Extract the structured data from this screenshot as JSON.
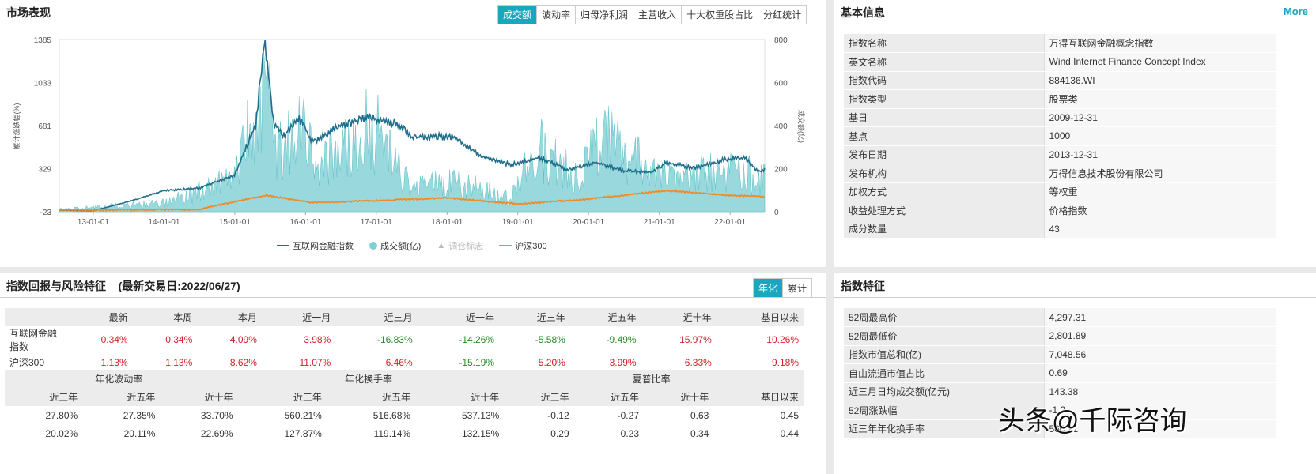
{
  "market": {
    "title": "市场表现",
    "tabs": [
      "成交额",
      "波动率",
      "归母净利润",
      "主营收入",
      "十大权重股占比",
      "分红统计"
    ],
    "legend": [
      "互联网金融指数",
      "成交额(亿)",
      "调仓标志",
      "沪深300"
    ],
    "ylabel_left": "累计涨跌幅(%)",
    "ylabel_right": "成交额(亿)"
  },
  "chart_data": {
    "type": "line",
    "x_ticks": [
      "13-01-01",
      "14-01-01",
      "15-01-01",
      "16-01-01",
      "17-01-01",
      "18-01-01",
      "19-01-01",
      "20-01-01",
      "21-01-01",
      "22-01-01"
    ],
    "y_left_ticks": [
      "1385",
      "1033",
      "681",
      "329",
      "-23"
    ],
    "y_right_ticks": [
      "800",
      "600",
      "400",
      "200",
      "0"
    ],
    "ylim_left": [
      -23,
      1385
    ],
    "ylim_right": [
      0,
      800
    ],
    "series": [
      {
        "name": "互联网金融指数",
        "color": "#1f6e8c",
        "points": [
          [
            2012.5,
            -10
          ],
          [
            2013.0,
            -15
          ],
          [
            2013.5,
            60
          ],
          [
            2014.0,
            150
          ],
          [
            2014.5,
            170
          ],
          [
            2015.0,
            280
          ],
          [
            2015.3,
            700
          ],
          [
            2015.42,
            1385
          ],
          [
            2015.55,
            700
          ],
          [
            2015.7,
            600
          ],
          [
            2015.9,
            750
          ],
          [
            2016.1,
            550
          ],
          [
            2016.5,
            680
          ],
          [
            2016.9,
            750
          ],
          [
            2017.3,
            700
          ],
          [
            2017.5,
            580
          ],
          [
            2017.8,
            600
          ],
          [
            2018.1,
            580
          ],
          [
            2018.5,
            430
          ],
          [
            2018.9,
            360
          ],
          [
            2019.3,
            420
          ],
          [
            2019.7,
            320
          ],
          [
            2020.1,
            380
          ],
          [
            2020.5,
            310
          ],
          [
            2020.9,
            300
          ],
          [
            2021.1,
            380
          ],
          [
            2021.5,
            330
          ],
          [
            2021.9,
            400
          ],
          [
            2022.2,
            420
          ],
          [
            2022.4,
            300
          ],
          [
            2022.5,
            330
          ]
        ]
      },
      {
        "name": "成交额(亿)",
        "color": "#7fd0d4",
        "axis": "right",
        "points": [
          [
            2012.5,
            10
          ],
          [
            2014.0,
            40
          ],
          [
            2015.0,
            150
          ],
          [
            2015.42,
            600
          ],
          [
            2015.6,
            250
          ],
          [
            2015.9,
            400
          ],
          [
            2016.2,
            200
          ],
          [
            2016.9,
            420
          ],
          [
            2017.5,
            100
          ],
          [
            2018.0,
            150
          ],
          [
            2018.9,
            60
          ],
          [
            2019.3,
            300
          ],
          [
            2019.8,
            150
          ],
          [
            2020.2,
            350
          ],
          [
            2020.6,
            250
          ],
          [
            2021.0,
            150
          ],
          [
            2022.0,
            200
          ],
          [
            2022.5,
            150
          ]
        ]
      },
      {
        "name": "沪深300",
        "color": "#f08a24",
        "points": [
          [
            2012.5,
            -10
          ],
          [
            2014.5,
            -5
          ],
          [
            2015.0,
            60
          ],
          [
            2015.45,
            110
          ],
          [
            2016.1,
            50
          ],
          [
            2018.0,
            90
          ],
          [
            2019.0,
            40
          ],
          [
            2020.0,
            80
          ],
          [
            2021.1,
            150
          ],
          [
            2022.0,
            110
          ],
          [
            2022.5,
            100
          ]
        ]
      }
    ]
  },
  "returns": {
    "title": "指数回报与风险特征",
    "date": "(最新交易日:2022/06/27)",
    "toggle": [
      "年化",
      "累计"
    ],
    "headers": [
      "",
      "最新",
      "本周",
      "本月",
      "近一月",
      "近三月",
      "近一年",
      "近三年",
      "近五年",
      "近十年",
      "基日以来"
    ],
    "rows": [
      [
        "互联网金融指数",
        "0.34%",
        "0.34%",
        "4.09%",
        "3.98%",
        "-16.83%",
        "-14.26%",
        "-5.58%",
        "-9.49%",
        "15.97%",
        "10.26%"
      ],
      [
        "沪深300",
        "1.13%",
        "1.13%",
        "8.62%",
        "11.07%",
        "6.46%",
        "-15.19%",
        "5.20%",
        "3.99%",
        "6.33%",
        "9.18%"
      ]
    ],
    "groups": [
      "年化波动率",
      "年化换手率",
      "夏普比率"
    ],
    "sub": [
      "近三年",
      "近五年",
      "近十年",
      "近三年",
      "近五年",
      "近十年",
      "近三年",
      "近五年",
      "近十年",
      "基日以来"
    ],
    "rows2": [
      [
        "27.80%",
        "27.35%",
        "33.70%",
        "560.21%",
        "516.68%",
        "537.13%",
        "-0.12",
        "-0.27",
        "0.63",
        "0.45"
      ],
      [
        "20.02%",
        "20.11%",
        "22.69%",
        "127.87%",
        "119.14%",
        "132.15%",
        "0.29",
        "0.23",
        "0.34",
        "0.44"
      ]
    ]
  },
  "info": {
    "title": "基本信息",
    "more": "More",
    "rows": [
      [
        "指数名称",
        "万得互联网金融概念指数"
      ],
      [
        "英文名称",
        "Wind Internet Finance Concept Index"
      ],
      [
        "指数代码",
        "884136.WI"
      ],
      [
        "指数类型",
        "股票类"
      ],
      [
        "基日",
        "2009-12-31"
      ],
      [
        "基点",
        "1000"
      ],
      [
        "发布日期",
        "2013-12-31"
      ],
      [
        "发布机构",
        "万得信息技术股份有限公司"
      ],
      [
        "加权方式",
        "等权重"
      ],
      [
        "收益处理方式",
        "价格指数"
      ],
      [
        "成分数量",
        "43"
      ]
    ]
  },
  "features": {
    "title": "指数特征",
    "rows": [
      [
        "52周最高价",
        "4,297.31"
      ],
      [
        "52周最低价",
        "2,801.89"
      ],
      [
        "指数市值总和(亿)",
        "7,048.56"
      ],
      [
        "自由流通市值占比",
        "0.69"
      ],
      [
        "近三月日均成交额(亿元)",
        "143.38"
      ],
      [
        "52周涨跌幅",
        "-1.2"
      ],
      [
        "近三年年化换手率",
        "560.21"
      ]
    ]
  },
  "watermark": "头条@千际咨询"
}
